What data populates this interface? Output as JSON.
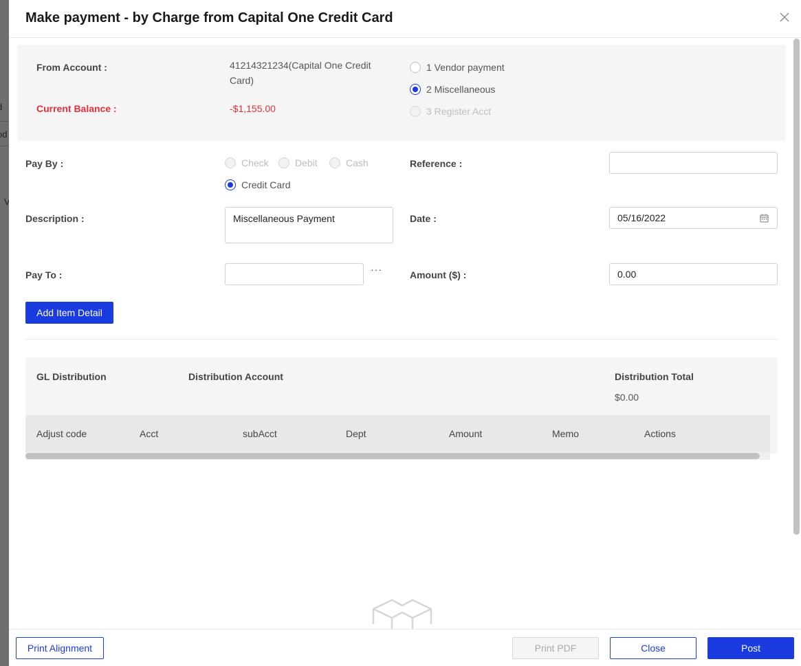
{
  "background": {
    "fragments": [
      "d",
      "od",
      "V"
    ]
  },
  "modal": {
    "title": "Make payment - by Charge from Capital One Credit Card"
  },
  "account": {
    "from_label": "From Account :",
    "from_value": "41214321234(Capital One Credit Card)",
    "balance_label": "Current Balance :",
    "balance_value": "-$1,155.00",
    "types": [
      {
        "label": "1 Vendor payment",
        "state": "unchecked"
      },
      {
        "label": "2 Miscellaneous",
        "state": "checked"
      },
      {
        "label": "3 Register Acct",
        "state": "disabled"
      }
    ]
  },
  "form": {
    "pay_by_label": "Pay By :",
    "pay_by_options": [
      {
        "label": "Check",
        "state": "disabled"
      },
      {
        "label": "Debit",
        "state": "disabled"
      },
      {
        "label": "Cash",
        "state": "disabled"
      },
      {
        "label": "Credit Card",
        "state": "checked"
      }
    ],
    "reference_label": "Reference :",
    "reference_value": "",
    "description_label": "Description :",
    "description_value": "Miscellaneous Payment",
    "date_label": "Date :",
    "date_value": "05/16/2022",
    "pay_to_label": "Pay To :",
    "pay_to_value": "",
    "pay_to_more": "···",
    "amount_label": "Amount ($) :",
    "amount_value": "0.00",
    "add_item_label": "Add Item Detail"
  },
  "gl": {
    "distribution_label": "GL Distribution",
    "account_label": "Distribution Account",
    "total_label": "Distribution Total",
    "total_value": "$0.00",
    "columns": [
      "Adjust code",
      "Acct",
      "subAcct",
      "Dept",
      "Amount",
      "Memo",
      "Actions"
    ]
  },
  "footer": {
    "print_alignment": "Print Alignment",
    "print_pdf": "Print PDF",
    "close": "Close",
    "post": "Post"
  },
  "colors": {
    "primary": "#1a3be0",
    "danger": "#e0313a"
  }
}
